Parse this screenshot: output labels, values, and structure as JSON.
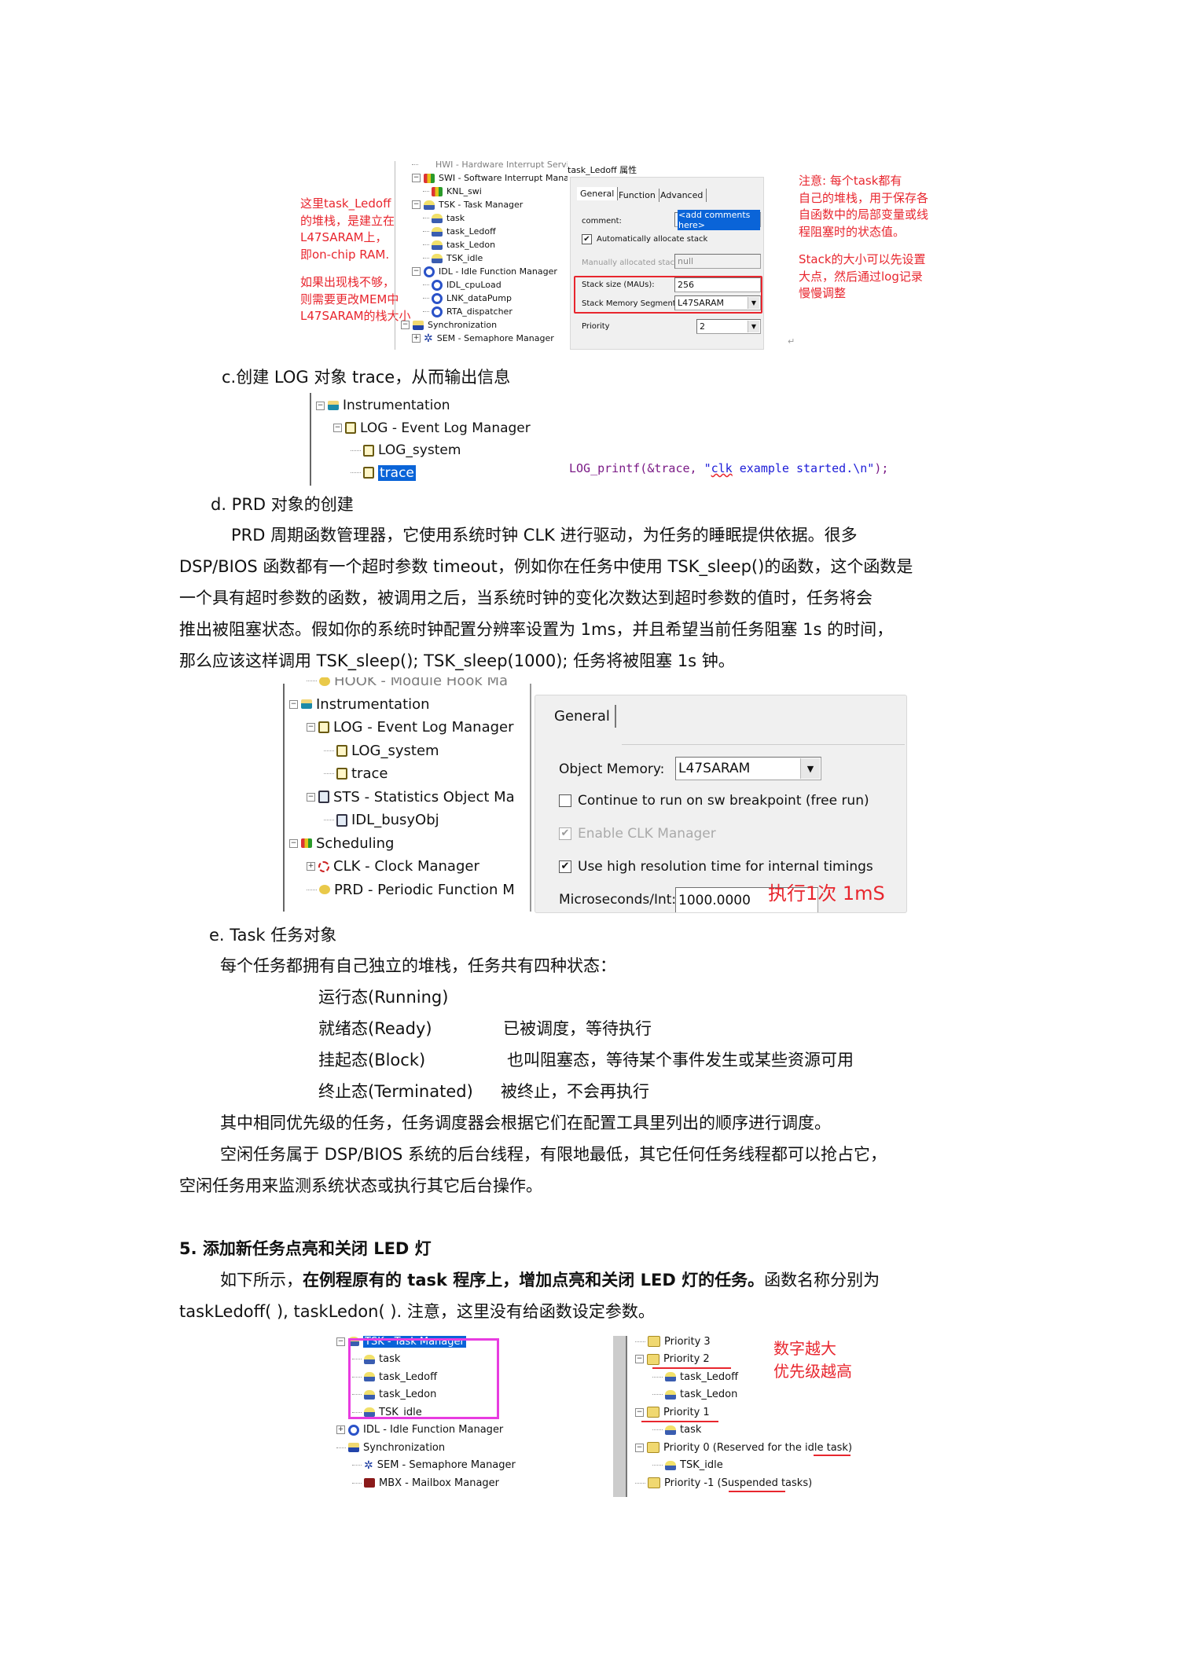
{
  "fig1": {
    "note_left": [
      "这里task_Ledoff",
      "的堆栈，是建立在",
      "L47SARAM上，",
      "即on-chip RAM.",
      "",
      "如果出现栈不够，",
      "则需要更改MEM中",
      "L47SARAM的栈大小"
    ],
    "tree": [
      {
        "label": "HWI - Hardware Interrupt Servi",
        "icon": "hwi",
        "cut": true
      },
      {
        "label": "SWI - Software Interrupt Manag",
        "icon": "swi",
        "expander": "−"
      },
      {
        "label": "KNL_swi",
        "icon": "swi"
      },
      {
        "label": "TSK - Task Manager",
        "icon": "task",
        "expander": "−"
      },
      {
        "label": "task",
        "icon": "task"
      },
      {
        "label": "task_Ledoff",
        "icon": "task"
      },
      {
        "label": "task_Ledon",
        "icon": "task"
      },
      {
        "label": "TSK_idle",
        "icon": "task"
      },
      {
        "label": "IDL - Idle Function Manager",
        "icon": "idl",
        "expander": "−"
      },
      {
        "label": "IDL_cpuLoad",
        "icon": "idl"
      },
      {
        "label": "LNK_dataPump",
        "icon": "idl"
      },
      {
        "label": "RTA_dispatcher",
        "icon": "idl"
      },
      {
        "label": "Synchronization",
        "icon": "sync",
        "expander": "−"
      },
      {
        "label": "SEM - Semaphore Manager",
        "icon": "sem",
        "expander": "+"
      }
    ],
    "dialog": {
      "title": "task_Ledoff 属性",
      "tabs": [
        "General",
        "Function",
        "Advanced"
      ],
      "comment_label": "comment:",
      "comment_value": "<add comments here>",
      "auto_alloc_label": "Automatically allocate stack",
      "auto_alloc_checked": true,
      "manual_label": "Manually allocated stack:",
      "manual_value": "null",
      "stack_size_label": "Stack size (MAUs):",
      "stack_size_value": "256",
      "segment_label": "Stack Memory Segment:",
      "segment_value": "L47SARAM",
      "priority_label": "Priority",
      "priority_value": "2"
    },
    "note_right": [
      "注意: 每个task都有",
      "自己的堆栈，用于保存各",
      "自函数中的局部变量或线",
      "程阻塞时的状态值。",
      "",
      "Stack的大小可以先设置",
      "大点，然后通过log记录",
      "慢慢调整"
    ]
  },
  "section_c": {
    "heading": "c.创建 LOG 对象 trace，从而输出信息",
    "tree": [
      {
        "label": "Instrumentation",
        "icon": "folder-i",
        "expander": "−"
      },
      {
        "label": "LOG - Event Log Manager",
        "icon": "log",
        "expander": "−"
      },
      {
        "label": "LOG_system",
        "icon": "log"
      },
      {
        "label": "trace",
        "icon": "log",
        "selected": true
      }
    ],
    "code": {
      "prefix": "LOG_printf(&trace, ",
      "string_open": "\"",
      "string_word": "clk",
      "string_rest": " example started.\\n\"",
      "suffix": ");"
    }
  },
  "section_d": {
    "heading": "d. PRD  对象的创建",
    "paragraph_lines": [
      "PRD  周期函数管理器，它使用系统时钟  CLK  进行驱动，为任务的睡眠提供依据。很多",
      "DSP/BIOS  函数都有一个超时参数 timeout，例如你在任务中使用 TSK_sleep()的函数，这个函数是",
      "一个具有超时参数的函数，被调用之后，当系统时钟的变化次数达到超时参数的值时，任务将会",
      "推出被阻塞状态。假如你的系统时钟配置分辨率设置为 1ms，并且希望当前任务阻塞 1s  的时间，",
      "那么应该这样调用 TSK_sleep();    TSK_sleep(1000);  任务将被阻塞 1s 钟。"
    ],
    "tree": [
      {
        "label": "HOOK - Module Hook Ma",
        "icon": "prd",
        "cut": true
      },
      {
        "label": "Instrumentation",
        "icon": "folder-i",
        "expander": "−"
      },
      {
        "label": "LOG - Event Log Manager",
        "icon": "log",
        "expander": "−"
      },
      {
        "label": "LOG_system",
        "icon": "log"
      },
      {
        "label": "trace",
        "icon": "log"
      },
      {
        "label": "STS - Statistics Object Ma",
        "icon": "sts",
        "expander": "−"
      },
      {
        "label": "IDL_busyObj",
        "icon": "sts"
      },
      {
        "label": "Scheduling",
        "icon": "swi",
        "expander": "−"
      },
      {
        "label": "CLK - Clock Manager",
        "icon": "clk",
        "expander": "+"
      },
      {
        "label": "PRD - Periodic Function M",
        "icon": "prd"
      }
    ],
    "dialog": {
      "tab": "General",
      "object_memory_label": "Object Memory:",
      "object_memory_value": "L47SARAM",
      "free_run_label": "Continue to run on sw breakpoint (free run)",
      "free_run_checked": false,
      "enable_clk_label": "Enable CLK Manager",
      "enable_clk_checked": true,
      "high_res_label": "Use high resolution time for internal timings",
      "high_res_checked": true,
      "us_per_int_label": "Microseconds/Int:",
      "us_per_int_value": "1000.0000",
      "annotation": "执行1次 1mS"
    }
  },
  "section_e": {
    "heading": "e. Task 任务对象",
    "intro": "每个任务都拥有自己独立的堆栈，任务共有四种状态：",
    "states": [
      {
        "name": "运行态(Running)",
        "desc": ""
      },
      {
        "name": "就绪态(Ready)",
        "desc": "已被调度，等待执行"
      },
      {
        "name": "挂起态(Block)",
        "desc": "也叫阻塞态，等待某个事件发生或某些资源可用"
      },
      {
        "name": "终止态(Terminated)",
        "desc": "被终止，不会再执行"
      }
    ],
    "para1": "其中相同优先级的任务，任务调度器会根据它们在配置工具里列出的顺序进行调度。",
    "para2_line1": "空闲任务属于  DSP/BIOS  系统的后台线程，有限地最低，其它任何任务线程都可以抢占它，",
    "para2_line2": "空闲任务用来监测系统状态或执行其它后台操作。"
  },
  "section_5": {
    "heading": "5.  添加新任务点亮和关闭 LED 灯",
    "line1_normal_a": "如下所示，",
    "line1_bold": "在例程原有的  task  程序上，增加点亮和关闭  LED  灯的任务。",
    "line1_normal_b": "函数名称分别为",
    "line2": "taskLedoff( ), taskLedon( ).  注意，这里没有给函数设定参数。",
    "tree_left": [
      {
        "label": "TSK - Task Manager",
        "icon": "task",
        "expander": "−",
        "selected": true
      },
      {
        "label": "task",
        "icon": "task"
      },
      {
        "label": "task_Ledoff",
        "icon": "task"
      },
      {
        "label": "task_Ledon",
        "icon": "task"
      },
      {
        "label": "TSK_idle",
        "icon": "task"
      },
      {
        "label": "IDL - Idle Function Manager",
        "icon": "idl",
        "expander": "+"
      },
      {
        "label": "Synchronization",
        "icon": "sync"
      },
      {
        "label": "SEM - Semaphore Manager",
        "icon": "sem"
      },
      {
        "label": "MBX - Mailbox Manager",
        "icon": "mbx"
      }
    ],
    "tree_right": [
      {
        "label": "Priority 3",
        "icon": "folder"
      },
      {
        "label": "Priority 2",
        "icon": "folder",
        "expander": "−"
      },
      {
        "label": "task_Ledoff",
        "icon": "task"
      },
      {
        "label": "task_Ledon",
        "icon": "task"
      },
      {
        "label": "Priority 1",
        "icon": "folder",
        "expander": "−"
      },
      {
        "label": "task",
        "icon": "task"
      },
      {
        "label": "Priority 0 (Reserved for the idle task)",
        "icon": "folder",
        "expander": "−"
      },
      {
        "label": "TSK_idle",
        "icon": "task"
      },
      {
        "label": "Priority -1 (Suspended tasks)",
        "icon": "folder"
      }
    ],
    "note": [
      "数字越大",
      "优先级越高"
    ]
  },
  "colors": {
    "annotation_red": "#e8262e",
    "highlight_blue": "#0a64d8",
    "magenta_box": "#e83ce0",
    "code_purple": "#7a1a86",
    "code_blue": "#1c1cd8"
  }
}
